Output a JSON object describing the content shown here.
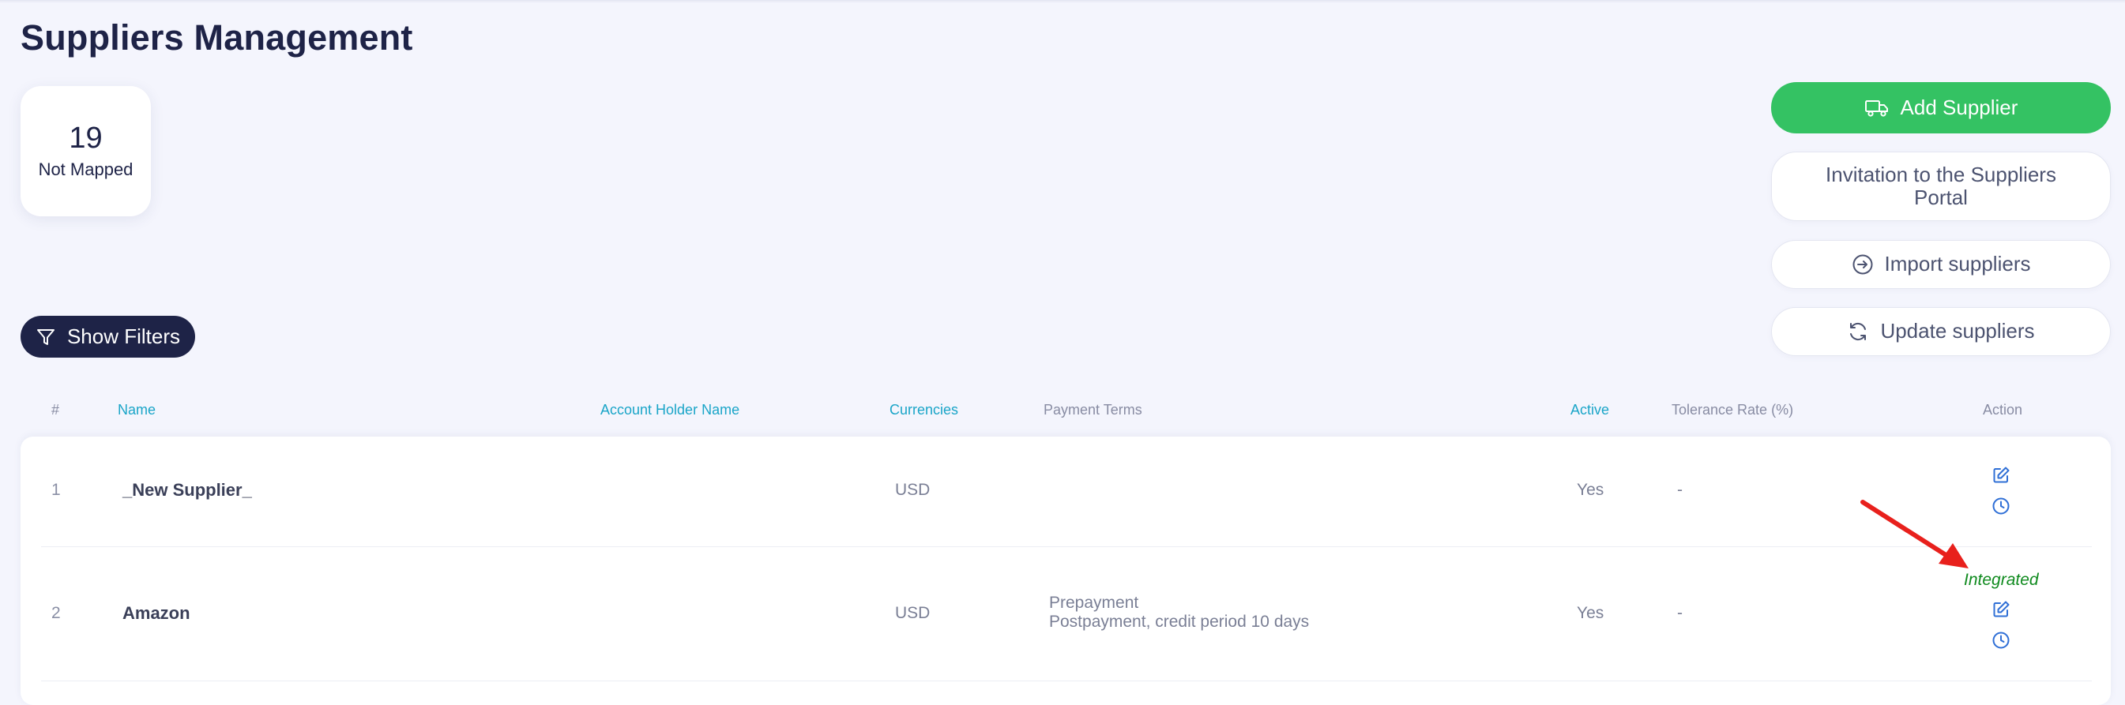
{
  "page": {
    "title": "Suppliers Management"
  },
  "stats": {
    "value": "19",
    "label": "Not Mapped"
  },
  "actions": {
    "add_supplier": "Add Supplier",
    "invite": "Invitation to the Suppliers Portal",
    "import": "Import suppliers",
    "update": "Update suppliers"
  },
  "filters": {
    "label": "Show Filters"
  },
  "table": {
    "columns": {
      "index": "#",
      "name": "Name",
      "account_holder": "Account Holder Name",
      "currencies": "Currencies",
      "payment_terms": "Payment Terms",
      "active": "Active",
      "tolerance": "Tolerance Rate (%)",
      "action": "Action"
    },
    "rows": [
      {
        "index": "1",
        "name": "_New Supplier_",
        "account_holder": "",
        "currency": "USD",
        "terms_line1": "",
        "terms_line2": "",
        "active": "Yes",
        "tolerance": "-",
        "status": ""
      },
      {
        "index": "2",
        "name": "Amazon",
        "account_holder": "",
        "currency": "USD",
        "terms_line1": "Prepayment",
        "terms_line2": "Postpayment, credit period 10 days",
        "active": "Yes",
        "tolerance": "-",
        "status": "Integrated"
      }
    ]
  },
  "icons": {
    "truck": "truck-icon",
    "import": "arrow-right-circle-icon",
    "update": "refresh-icon",
    "filter": "filter-funnel-icon",
    "edit": "edit-icon",
    "history": "clock-icon"
  },
  "colors": {
    "primary_dark": "#1e2347",
    "accent_green": "#34c263",
    "link_blue": "#1aa5c8",
    "icon_blue": "#2f6fd6",
    "status_green": "#0f8a1e",
    "annotation_red": "#e8201c"
  }
}
